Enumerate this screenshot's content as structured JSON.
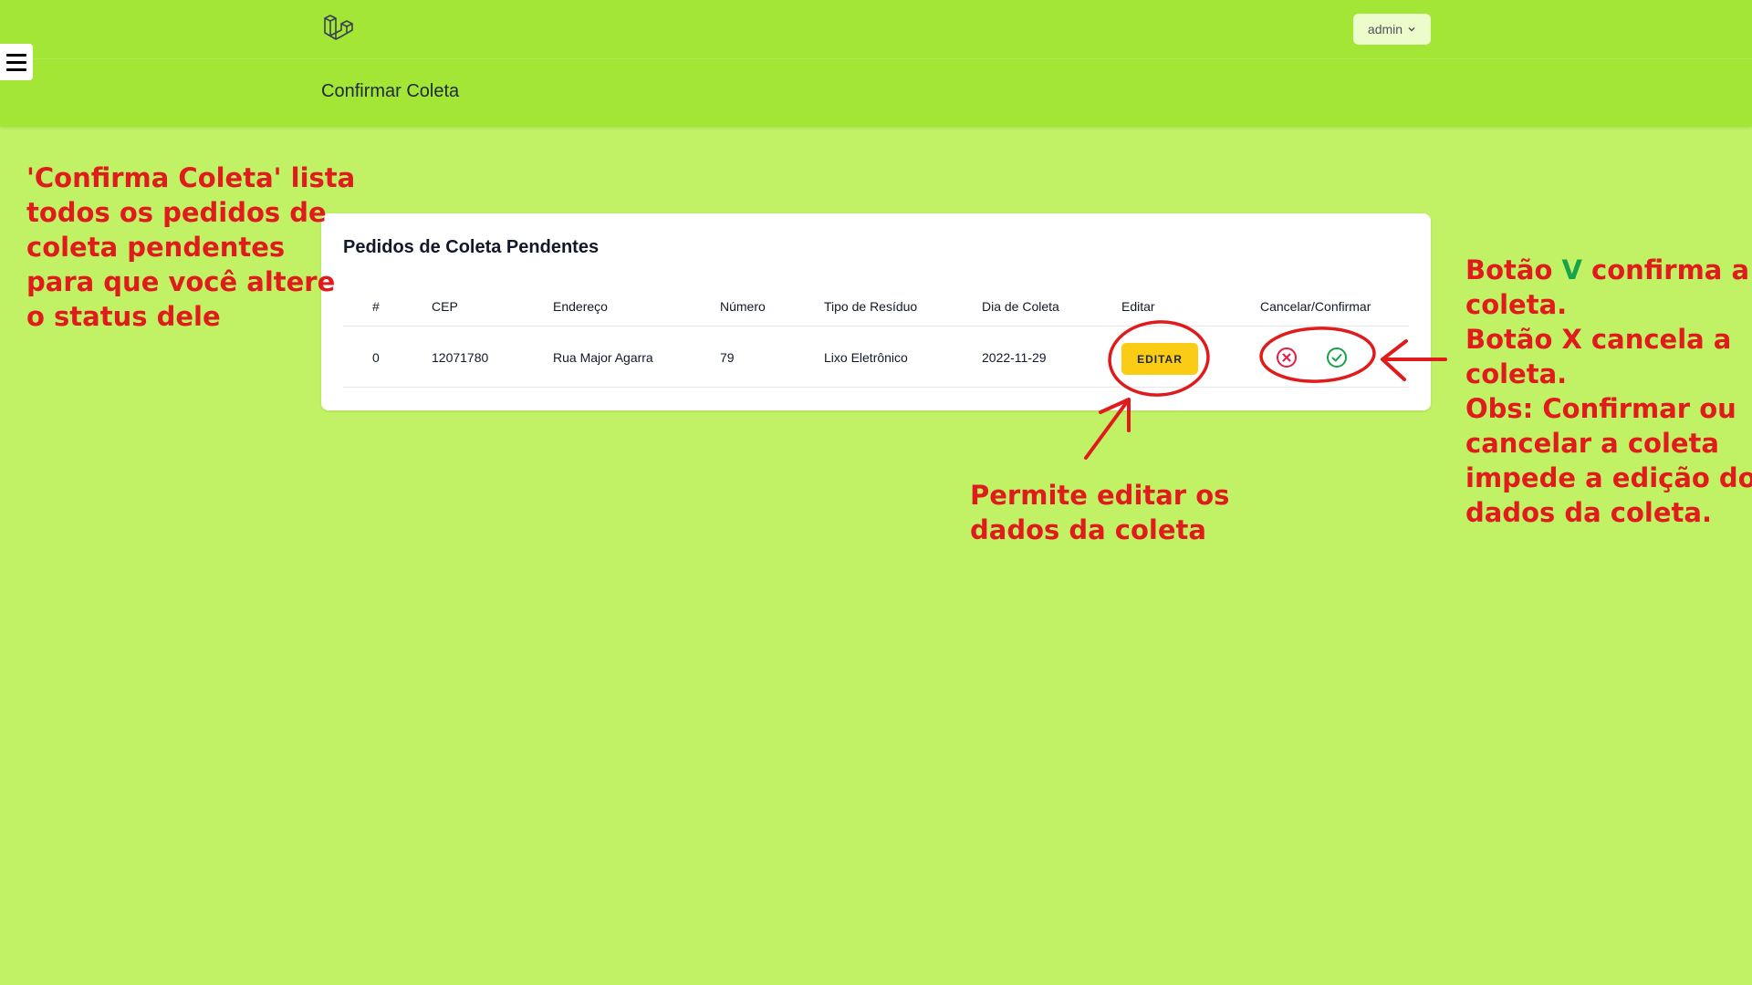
{
  "header": {
    "user_menu_label": "admin",
    "page_title": "Confirmar Coleta"
  },
  "card": {
    "title": "Pedidos de Coleta Pendentes",
    "columns": [
      "#",
      "CEP",
      "Endereço",
      "Número",
      "Tipo de Resíduo",
      "Dia de Coleta",
      "Editar",
      "Cancelar/Confirmar"
    ],
    "rows": [
      {
        "id": "0",
        "cep": "12071780",
        "endereco": "Rua Major Agarra",
        "numero": "79",
        "tipo": "Lixo Eletrônico",
        "dia": "2022-11-29",
        "edit_label": "EDITAR"
      }
    ]
  },
  "annotations": {
    "left": [
      "'Confirma Coleta' lista",
      "todos os pedidos de",
      "coleta pendentes",
      "para que você altere",
      "o status dele"
    ],
    "middle": [
      "Permite editar os",
      "dados da coleta"
    ],
    "right_line1_a": "Botão ",
    "right_line1_v": "V",
    "right_line1_b": " confirma a",
    "right_rest": [
      "coleta.",
      "Botão X cancela a",
      "coleta.",
      "Obs: Confirmar ou",
      "cancelar a coleta",
      "impede a edição dos",
      "dados da coleta."
    ]
  },
  "colors": {
    "page_bg": "#c1f266",
    "header_bg": "#a3e635",
    "annotation": "#e01b1b",
    "edit_button": "#facc15",
    "cancel_icon": "#e11d48",
    "confirm_icon": "#16a34a"
  }
}
